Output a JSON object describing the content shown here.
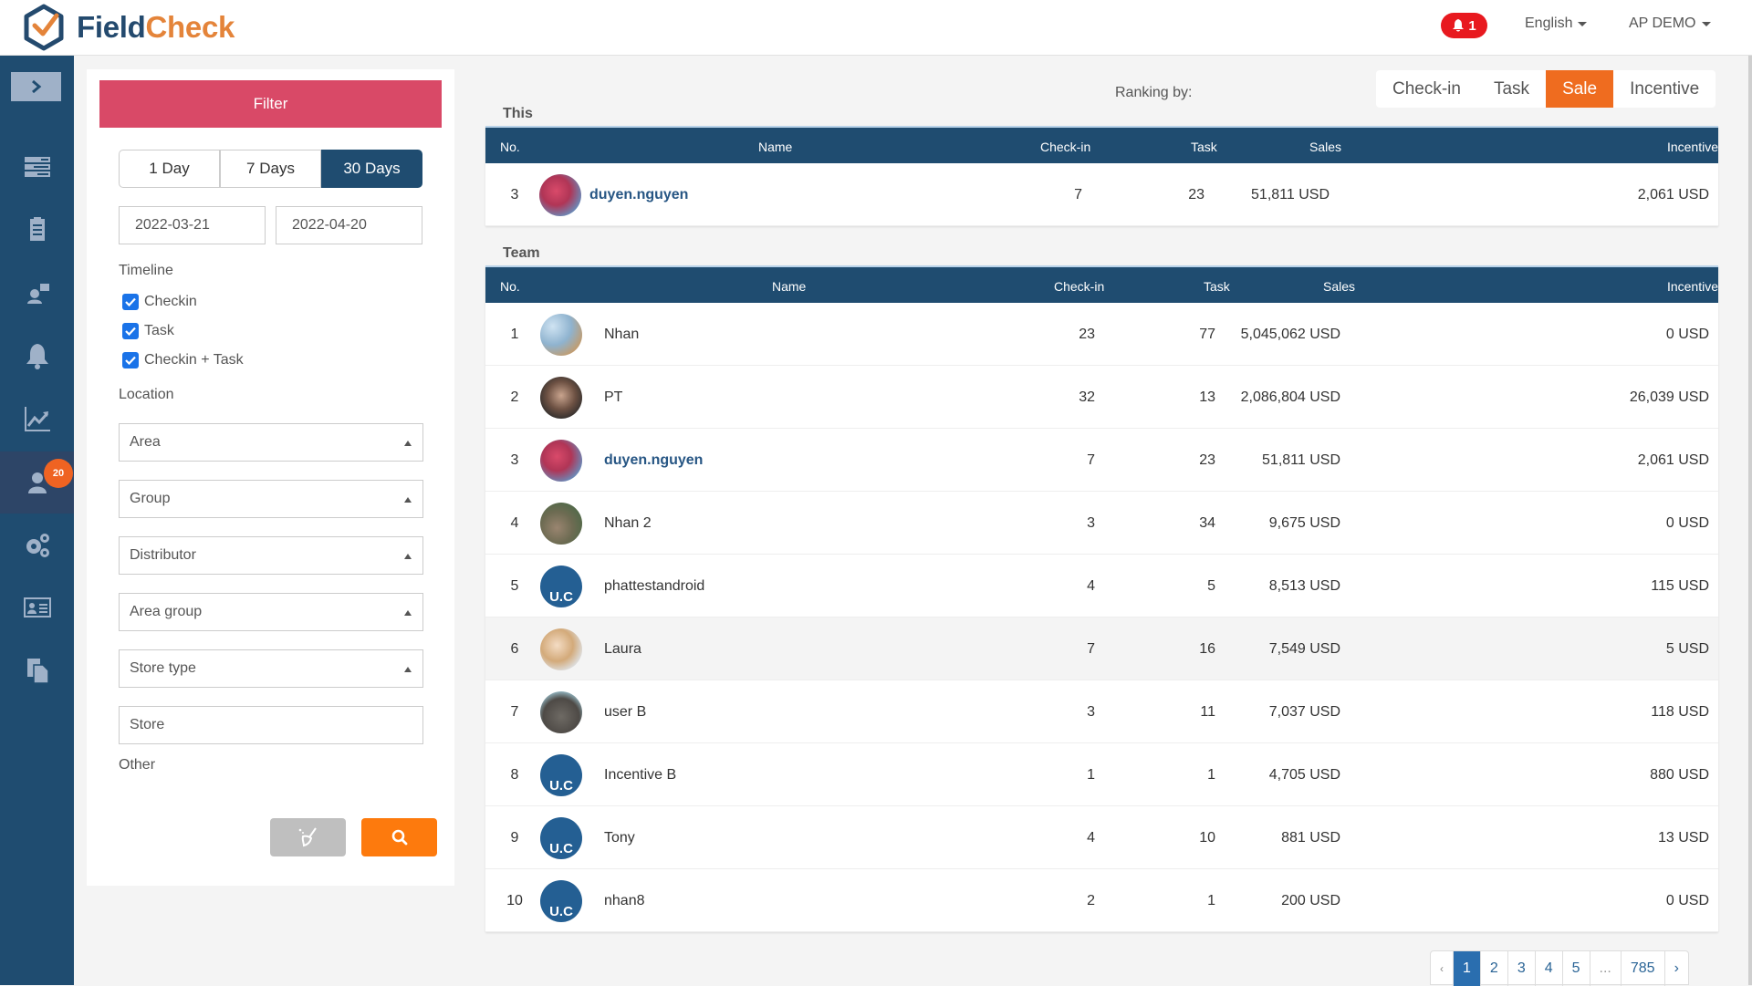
{
  "header": {
    "logo_part1": "Field",
    "logo_part2": "Check",
    "notification_count": "1",
    "language": "English",
    "user": "AP DEMO"
  },
  "sidebar": {
    "items": [
      {
        "icon": "list-icon"
      },
      {
        "icon": "clipboard-icon"
      },
      {
        "icon": "chat-user-icon"
      },
      {
        "icon": "bell-icon"
      },
      {
        "icon": "chart-icon"
      },
      {
        "icon": "user-icon",
        "active": true,
        "badge": "20"
      },
      {
        "icon": "gears-icon"
      },
      {
        "icon": "id-card-icon"
      },
      {
        "icon": "documents-icon"
      }
    ]
  },
  "filter": {
    "title": "Filter",
    "ranges": [
      "1 Day",
      "7 Days",
      "30 Days"
    ],
    "active_range": "30 Days",
    "date_from": "2022-03-21",
    "date_to": "2022-04-20",
    "timeline_label": "Timeline",
    "checkboxes": [
      {
        "label": "Checkin",
        "checked": true
      },
      {
        "label": "Task",
        "checked": true
      },
      {
        "label": "Checkin + Task",
        "checked": true
      }
    ],
    "location_label": "Location",
    "selects": [
      "Area",
      "Group",
      "Distributor",
      "Area group",
      "Store type"
    ],
    "store_placeholder": "Store",
    "other_label": "Other"
  },
  "ranking": {
    "label": "Ranking by:",
    "tabs": [
      "Check-in",
      "Task",
      "Sale",
      "Incentive"
    ],
    "active": "Sale"
  },
  "columns": {
    "no": "No.",
    "name": "Name",
    "checkin": "Check-in",
    "task": "Task",
    "sales": "Sales",
    "incentive": "Incentive"
  },
  "this_section": {
    "title": "This",
    "row": {
      "no": "3",
      "name": "duyen.nguyen",
      "checkin": "7",
      "task": "23",
      "sales": "51,811 USD",
      "incentive": "2,061 USD"
    }
  },
  "team_section": {
    "title": "Team",
    "rows": [
      {
        "no": "1",
        "name": "Nhan",
        "checkin": "23",
        "task": "77",
        "sales": "5,045,062 USD",
        "incentive": "0 USD",
        "avatar": "photo"
      },
      {
        "no": "2",
        "name": "PT",
        "checkin": "32",
        "task": "13",
        "sales": "2,086,804 USD",
        "incentive": "26,039 USD",
        "avatar": "photo"
      },
      {
        "no": "3",
        "name": "duyen.nguyen",
        "checkin": "7",
        "task": "23",
        "sales": "51,811 USD",
        "incentive": "2,061 USD",
        "avatar": "photo",
        "current": true
      },
      {
        "no": "4",
        "name": "Nhan 2",
        "checkin": "3",
        "task": "34",
        "sales": "9,675 USD",
        "incentive": "0 USD",
        "avatar": "photo"
      },
      {
        "no": "5",
        "name": "phattestandroid",
        "checkin": "4",
        "task": "5",
        "sales": "8,513 USD",
        "incentive": "115 USD",
        "avatar": "U.C"
      },
      {
        "no": "6",
        "name": "Laura",
        "checkin": "7",
        "task": "16",
        "sales": "7,549 USD",
        "incentive": "5 USD",
        "avatar": "photo",
        "hover": true
      },
      {
        "no": "7",
        "name": "user B",
        "checkin": "3",
        "task": "11",
        "sales": "7,037 USD",
        "incentive": "118 USD",
        "avatar": "photo"
      },
      {
        "no": "8",
        "name": "Incentive B",
        "checkin": "1",
        "task": "1",
        "sales": "4,705 USD",
        "incentive": "880 USD",
        "avatar": "U.C"
      },
      {
        "no": "9",
        "name": "Tony",
        "checkin": "4",
        "task": "10",
        "sales": "881 USD",
        "incentive": "13 USD",
        "avatar": "U.C"
      },
      {
        "no": "10",
        "name": "nhan8",
        "checkin": "2",
        "task": "1",
        "sales": "200 USD",
        "incentive": "0 USD",
        "avatar": "U.C"
      }
    ]
  },
  "pagination": {
    "prev": "‹",
    "pages": [
      "1",
      "2",
      "3",
      "4",
      "5",
      "...",
      "785"
    ],
    "current": "1",
    "next": "›"
  },
  "colors": {
    "primary": "#1f4c70",
    "accent": "#ef6c1f",
    "filter_header": "#d94967",
    "badge": "#ef6322"
  }
}
